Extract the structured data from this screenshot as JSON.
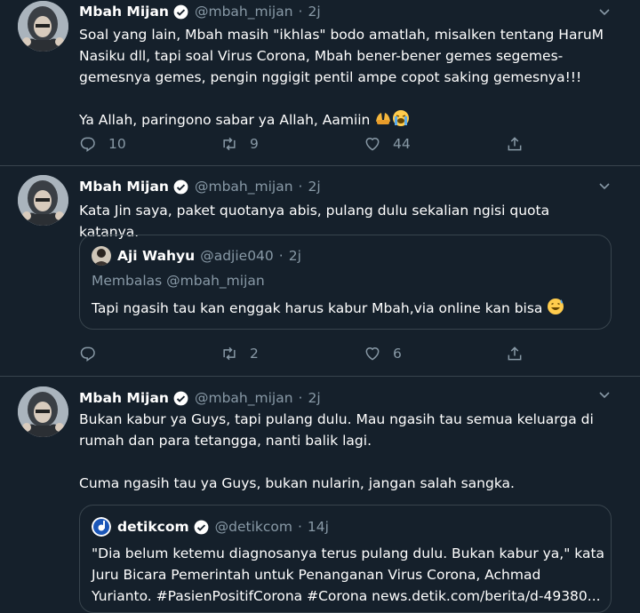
{
  "tweets": [
    {
      "name": "Mbah Mijan",
      "handle": "@mbah_mijan",
      "dot": "·",
      "time": "2j",
      "paragraphs": [
        "Soal yang lain, Mbah masih \"ikhlas\" bodo amatlah, misalken tentang HaruM Nasiku dll, tapi soal Virus Corona, Mbah bener-bener gemes segemes-gemesnya gemes, pengin nggigit pentil ampe copot saking gemesnya!!!",
        "Ya Allah, paringono sabar ya Allah, Aamiin"
      ],
      "emoji": [
        "palms-up-together",
        "loudly-crying-face"
      ],
      "replies": "10",
      "retweets": "9",
      "likes": "44"
    },
    {
      "name": "Mbah Mijan",
      "handle": "@mbah_mijan",
      "dot": "·",
      "time": "2j",
      "paragraphs": [
        "Kata Jin saya, paket quotanya abis, pulang dulu sekalian ngisi quota katanya."
      ],
      "quote": {
        "name": "Aji Wahyu",
        "handle": "@adjie040",
        "dot": "·",
        "time": "2j",
        "reply_to": "Membalas @mbah_mijan",
        "text": "Tapi ngasih tau kan enggak harus kabur Mbah,via online kan bisa",
        "emoji": "grinning-face-with-sweat"
      },
      "replies": "",
      "retweets": "2",
      "likes": "6"
    },
    {
      "name": "Mbah Mijan",
      "handle": "@mbah_mijan",
      "dot": "·",
      "time": "2j",
      "paragraphs": [
        "Bukan kabur ya Guys, tapi pulang dulu. Mau ngasih tau semua keluarga di rumah dan para tetangga, nanti balik lagi.",
        "Cuma ngasih tau ya Guys, bukan nularin, jangan salah sangka."
      ],
      "quote": {
        "name": "detikcom",
        "handle": "@detikcom",
        "dot": "·",
        "time": "14j",
        "text_lines": [
          "\"Dia belum ketemu diagnosanya terus pulang dulu. Bukan kabur ya,\" kata",
          "Juru Bicara Pemerintah untuk Penanganan Virus Corona, Achmad",
          "Yurianto. #PasienPositifCorona #Corona news.detik.com/berita/d-49380..."
        ]
      }
    }
  ],
  "colors": {
    "background": "#15202b",
    "border": "#38444d",
    "muted": "#8899a6",
    "verified": "#ffffff"
  }
}
